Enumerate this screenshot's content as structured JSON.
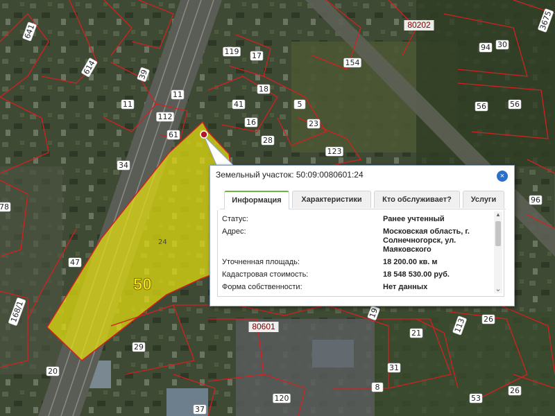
{
  "map": {
    "parcel_labels": [
      "641",
      "614",
      "39",
      "11",
      "112",
      "11",
      "119",
      "17",
      "18",
      "41",
      "5",
      "16",
      "23",
      "28",
      "123",
      "154",
      "56",
      "56",
      "94",
      "30",
      "3675",
      "61",
      "34",
      "47",
      "78",
      "168/1",
      "20",
      "29",
      "37",
      "120",
      "53",
      "26",
      "21",
      "31",
      "113",
      "19",
      "96",
      "26",
      "8"
    ],
    "block_labels": [
      "80202",
      "80601"
    ],
    "selected_parcel_number": "50",
    "selected_parcel_small_label": "24",
    "colors": {
      "selection_fill": "#e6e10f",
      "boundary": "#d42020",
      "imagery_base": "#3d4832"
    }
  },
  "popup": {
    "title": "Земельный участок: 50:09:0080601:24",
    "close_label": "×",
    "tabs": [
      {
        "label": "Информация",
        "active": true
      },
      {
        "label": "Характеристики",
        "active": false
      },
      {
        "label": "Кто обслуживает?",
        "active": false
      },
      {
        "label": "Услуги",
        "active": false
      }
    ],
    "fields": [
      {
        "key": "Статус:",
        "value": "Ранее учтенный"
      },
      {
        "key": "Адрес:",
        "value": "Московская область, г. Солнечногорск, ул. Маяковского"
      },
      {
        "key": "Уточненная площадь:",
        "value": "18 200.00 кв. м"
      },
      {
        "key": "Кадастровая стоимость:",
        "value": "18 548 530.00 руб."
      },
      {
        "key": "Форма собственности:",
        "value": "Нет данных"
      }
    ],
    "scroll_up": "▲",
    "scroll_down": "⌄"
  }
}
